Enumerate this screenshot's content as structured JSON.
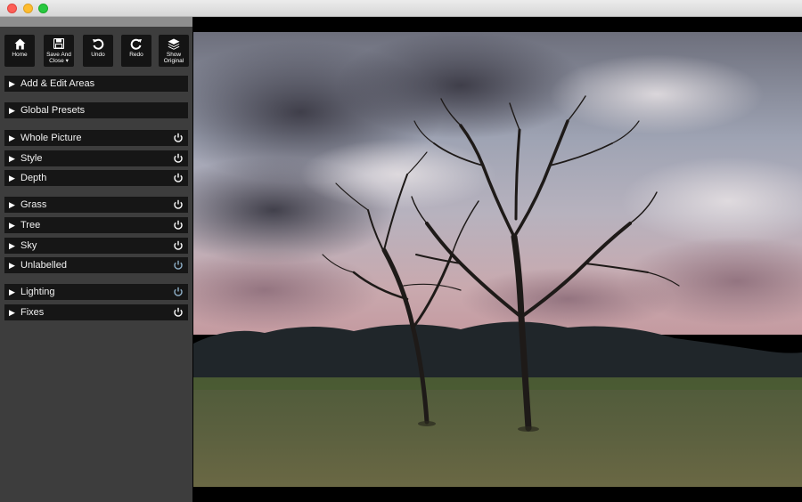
{
  "toolbar": {
    "home": "Home",
    "save_line1": "Save And",
    "save_line2": "Close ▾",
    "undo": "Undo",
    "redo": "Redo",
    "show_line1": "Show",
    "show_line2": "Original"
  },
  "sections": {
    "add_edit_areas": "Add & Edit Areas",
    "global_presets": "Global Presets",
    "whole_picture": "Whole Picture",
    "style": "Style",
    "depth": "Depth",
    "grass": "Grass",
    "tree": "Tree",
    "sky": "Sky",
    "unlabelled": "Unlabelled",
    "lighting": "Lighting",
    "fixes": "Fixes"
  },
  "icons": {
    "expand": "triangle-right-icon",
    "toggle": "power-icon"
  },
  "colors": {
    "sidebar_bg": "#3d3d3d",
    "row_bg": "#161616",
    "power_on": "#ffffff",
    "power_dim": "#8fb0c8"
  }
}
